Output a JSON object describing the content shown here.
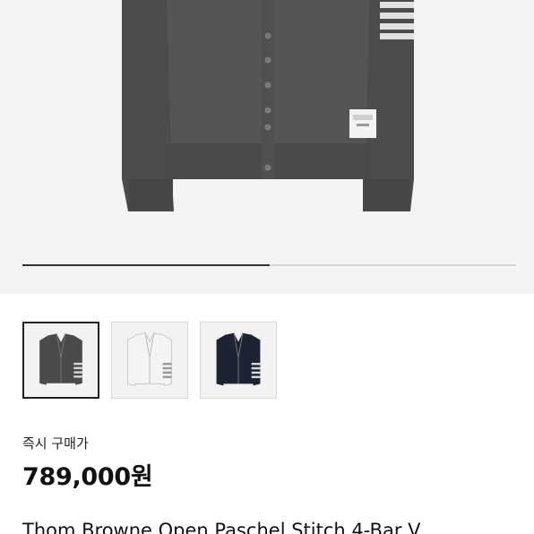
{
  "product": {
    "gallery": {
      "progress": 0.5,
      "thumbnails": [
        {
          "name": "thumbnail-grey-cardigan",
          "color": "#4a4a4a",
          "active": true
        },
        {
          "name": "thumbnail-white-cardigan",
          "color": "#f4f4f4",
          "active": false
        },
        {
          "name": "thumbnail-navy-cardigan",
          "color": "#1c2433",
          "active": false
        }
      ]
    },
    "price_label": "즉시 구매가",
    "price": "789,000원",
    "title": "Thom Browne Open Paschel Stitch 4-Bar V"
  }
}
